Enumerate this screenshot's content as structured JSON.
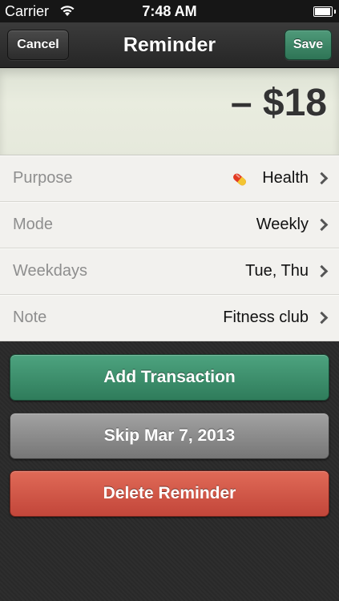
{
  "status_bar": {
    "carrier": "Carrier",
    "time": "7:48 AM",
    "icons": [
      "wifi-icon",
      "battery-icon"
    ]
  },
  "nav": {
    "title": "Reminder",
    "cancel_label": "Cancel",
    "save_label": "Save"
  },
  "amount": "– $18",
  "rows": [
    {
      "label": "Purpose",
      "value": "Health",
      "icon": "pill-icon"
    },
    {
      "label": "Mode",
      "value": "Weekly"
    },
    {
      "label": "Weekdays",
      "value": "Tue, Thu"
    },
    {
      "label": "Note",
      "value": "Fitness club"
    }
  ],
  "actions": {
    "add_label": "Add Transaction",
    "skip_label": "Skip Mar 7, 2013",
    "delete_label": "Delete Reminder"
  },
  "colors": {
    "accent_green": "#3f8f6c",
    "delete_red": "#d0574a",
    "skip_gray": "#8c8c8c",
    "nav_dark": "#2e2e2e"
  }
}
